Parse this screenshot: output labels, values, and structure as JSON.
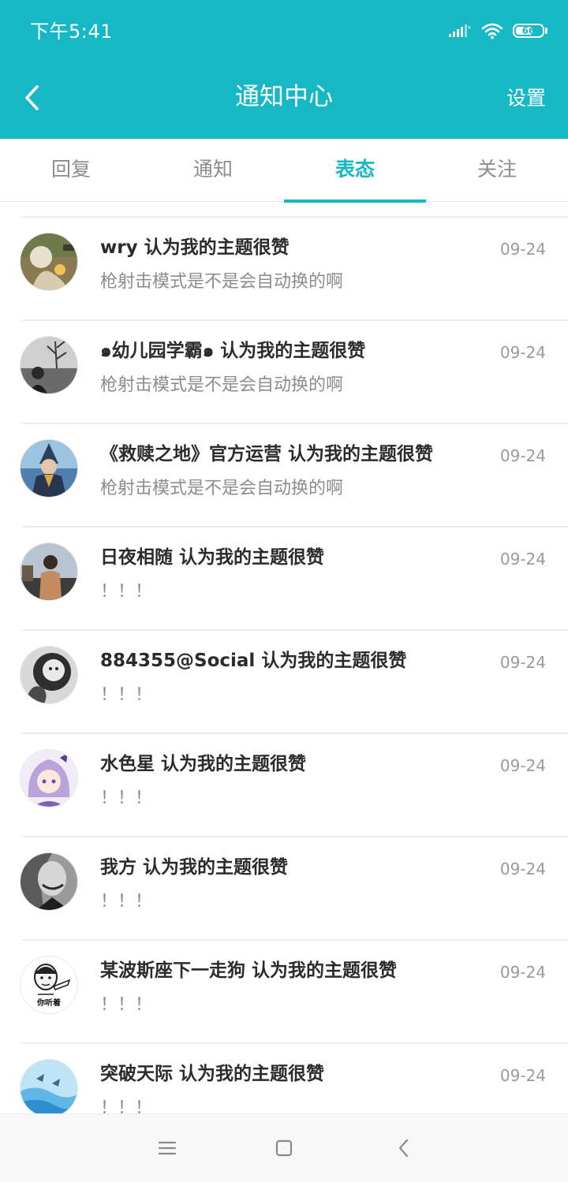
{
  "colors": {
    "accent": "#17b8c6",
    "title_text": "#2b2b2b",
    "secondary_text": "#8c8c8c",
    "date_text": "#9a9a9a",
    "divider": "#ececec",
    "nav_bar": "#f8f8f8"
  },
  "status_bar": {
    "time": "下午5:41",
    "battery_level": "66",
    "icons": [
      "signal-icon",
      "wifi-icon",
      "battery-icon"
    ]
  },
  "header": {
    "back_icon": "chevron-left-icon",
    "title": "通知中心",
    "settings_label": "设置"
  },
  "tabs": [
    {
      "label": "回复",
      "active": false
    },
    {
      "label": "通知",
      "active": false
    },
    {
      "label": "表态",
      "active": true
    },
    {
      "label": "关注",
      "active": false
    }
  ],
  "notifications": [
    {
      "title": "wry 认为我的主题很赞",
      "subtitle": "枪射击模式是不是会自动换的啊",
      "date": "09-24"
    },
    {
      "title": "๑幼儿园学霸๑ 认为我的主题很赞",
      "subtitle": "枪射击模式是不是会自动换的啊",
      "date": "09-24"
    },
    {
      "title": "《救赎之地》官方运营 认为我的主题很赞",
      "subtitle": "枪射击模式是不是会自动换的啊",
      "date": "09-24"
    },
    {
      "title": "日夜相随 认为我的主题很赞",
      "subtitle": "！！！",
      "date": "09-24"
    },
    {
      "title": "884355@Social 认为我的主题很赞",
      "subtitle": "！！！",
      "date": "09-24"
    },
    {
      "title": "水色星 认为我的主题很赞",
      "subtitle": "！！！",
      "date": "09-24"
    },
    {
      "title": "我方 认为我的主题很赞",
      "subtitle": "！！！",
      "date": "09-24"
    },
    {
      "title": "某波斯座下一走狗 认为我的主题很赞",
      "subtitle": "！！！",
      "date": "09-24",
      "avatar_text": "你听着"
    },
    {
      "title": "突破天际 认为我的主题很赞",
      "subtitle": "！！！",
      "date": "09-24"
    }
  ],
  "nav_bar": {
    "icons": [
      "menu-icon",
      "home-square-icon",
      "back-triangle-icon"
    ]
  }
}
